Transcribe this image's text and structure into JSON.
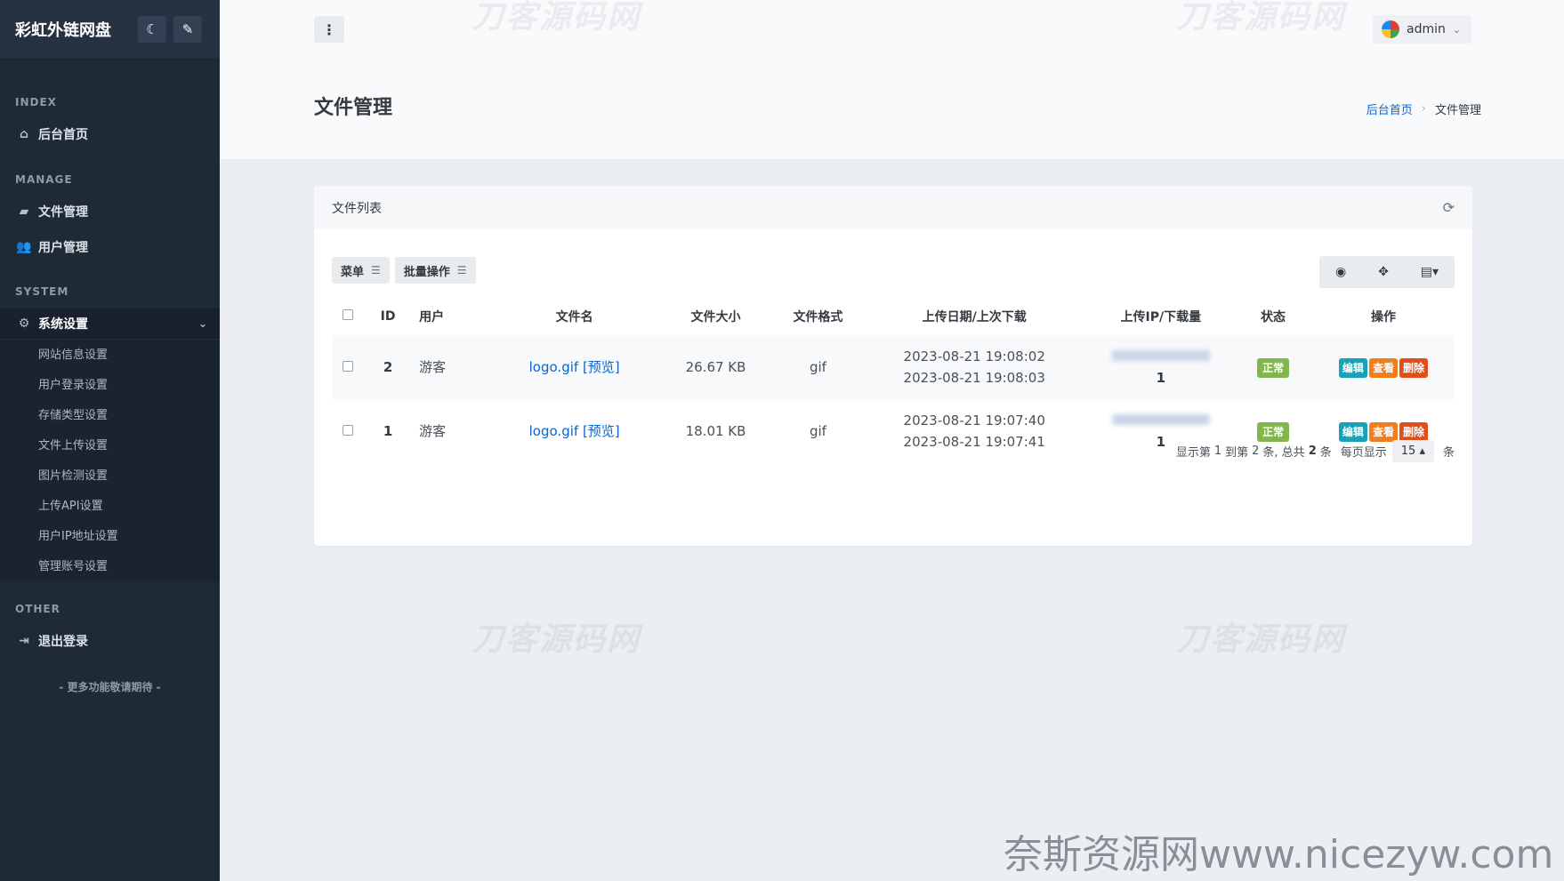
{
  "app": {
    "title": "彩虹外链网盘",
    "theme_icon": "moon-icon",
    "brush_icon": "brush-icon"
  },
  "sidebar": {
    "sections": [
      {
        "label": "INDEX"
      },
      {
        "label": "MANAGE"
      },
      {
        "label": "SYSTEM"
      },
      {
        "label": "OTHER"
      }
    ],
    "items": [
      {
        "label": "后台首页",
        "icon": "home-icon"
      },
      {
        "label": "文件管理",
        "icon": "folder-icon"
      },
      {
        "label": "用户管理",
        "icon": "users-icon"
      },
      {
        "label": "系统设置",
        "icon": "gear-icon"
      },
      {
        "label": "退出登录",
        "icon": "logout-icon"
      }
    ],
    "subitems": [
      "网站信息设置",
      "用户登录设置",
      "存储类型设置",
      "文件上传设置",
      "图片检测设置",
      "上传API设置",
      "用户IP地址设置",
      "管理账号设置"
    ],
    "footer": "- 更多功能敬请期待 -"
  },
  "header": {
    "menu_icon": "⋮",
    "username": "admin"
  },
  "page": {
    "title": "文件管理"
  },
  "breadcrumb": {
    "home": "后台首页",
    "current": "文件管理"
  },
  "card": {
    "title": "文件列表",
    "toolbar": {
      "menu_label": "菜单",
      "batch_label": "批量操作"
    }
  },
  "table": {
    "columns": [
      "ID",
      "用户",
      "文件名",
      "文件大小",
      "文件格式",
      "上传日期/上次下载",
      "上传IP/下载量",
      "状态",
      "操作"
    ],
    "rows": [
      {
        "id": "2",
        "user": "游客",
        "filename": "logo.gif",
        "preview": "[预览]",
        "size": "26.67 KB",
        "format": "gif",
        "upload_date": "2023-08-21 19:08:02",
        "last_download": "2023-08-21 19:08:03",
        "downloads": "1",
        "status": "正常"
      },
      {
        "id": "1",
        "user": "游客",
        "filename": "logo.gif",
        "preview": "[预览]",
        "size": "18.01 KB",
        "format": "gif",
        "upload_date": "2023-08-21 19:07:40",
        "last_download": "2023-08-21 19:07:41",
        "downloads": "1",
        "status": "正常"
      }
    ],
    "actions": {
      "edit": "编辑",
      "view": "查看",
      "delete": "删除"
    }
  },
  "pager": {
    "prefix": "显示第",
    "from": "1",
    "mid1": "到第",
    "to": "2",
    "mid2": "条, 总共",
    "total": "2",
    "mid3": "条",
    "per_page_label": "每页显示",
    "per_page": "15",
    "suffix": "条"
  },
  "watermark": "刀客源码网",
  "site_mark": "奈斯资源网www.nicezyw.com",
  "colors": {
    "sidebar_bg": "#1f2a37",
    "accent": "#0665d0",
    "status_ok": "#82b54b",
    "edit": "#17a2b8",
    "view": "#f27d1c",
    "delete": "#e04f1a"
  }
}
